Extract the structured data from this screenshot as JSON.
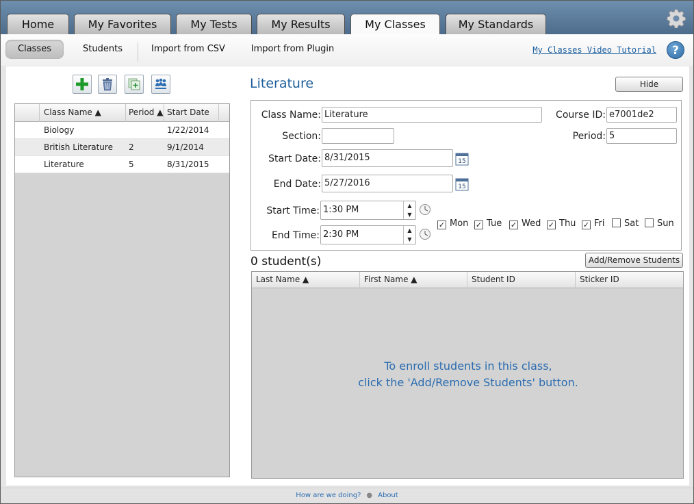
{
  "tabs": [
    "Home",
    "My Favorites",
    "My Tests",
    "My Results",
    "My Classes",
    "My Standards"
  ],
  "active_tab": "My Classes",
  "subnav": {
    "items": [
      "Classes",
      "Students",
      "Import from CSV",
      "Import from Plugin"
    ],
    "active": "Classes",
    "video_link": "My Classes Video Tutorial",
    "help": "?"
  },
  "class_grid": {
    "headers": [
      "Class Name ▲",
      "Period ▲",
      "Start Date"
    ],
    "rows": [
      {
        "name": "Biology",
        "period": "",
        "start": "1/22/2014"
      },
      {
        "name": "British Literature",
        "period": "2",
        "start": "9/1/2014"
      },
      {
        "name": "Literature",
        "period": "5",
        "start": "8/31/2015"
      }
    ]
  },
  "detail": {
    "title": "Literature",
    "hide_label": "Hide",
    "class_name_label": "Class Name:",
    "class_name": "Literature",
    "course_id_label": "Course ID:",
    "course_id": "e7001de2",
    "section_label": "Section:",
    "section": "",
    "period_label": "Period:",
    "period": "5",
    "start_date_label": "Start Date:",
    "start_date": "8/31/2015",
    "end_date_label": "End Date:",
    "end_date": "5/27/2016",
    "calendar_day": "15",
    "start_time_label": "Start Time:",
    "start_time": "1:30 PM",
    "end_time_label": "End Time:",
    "end_time": "2:30 PM",
    "days": [
      {
        "label": "Mon",
        "checked": true
      },
      {
        "label": "Tue",
        "checked": true
      },
      {
        "label": "Wed",
        "checked": true
      },
      {
        "label": "Thu",
        "checked": true
      },
      {
        "label": "Fri",
        "checked": true
      },
      {
        "label": "Sat",
        "checked": false
      },
      {
        "label": "Sun",
        "checked": false
      }
    ]
  },
  "students": {
    "count_text": "0 student(s)",
    "add_remove_label": "Add/Remove Students",
    "headers": [
      "Last Name ▲",
      "First Name ▲",
      "Student ID",
      "Sticker ID"
    ],
    "empty_line1": "To enroll students in this class,",
    "empty_line2": "click the 'Add/Remove Students' button."
  },
  "footer": {
    "feedback": "How are we doing?",
    "about": "About"
  },
  "colors": {
    "accent": "#1c5d99",
    "link": "#2a6cb0",
    "topbar": "#5a7a9a",
    "add_green": "#1e9a2a"
  }
}
